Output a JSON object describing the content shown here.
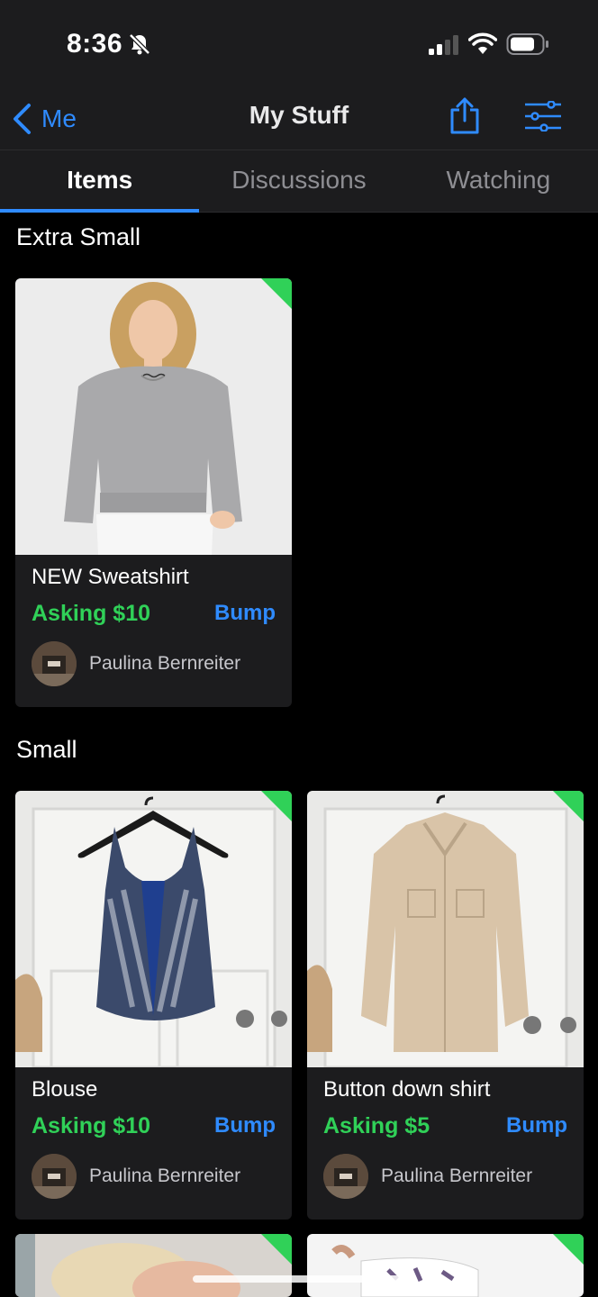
{
  "status_bar": {
    "time": "8:36"
  },
  "nav": {
    "back_label": "Me",
    "title": "My Stuff"
  },
  "tabs": [
    {
      "label": "Items",
      "active": true
    },
    {
      "label": "Discussions",
      "active": false
    },
    {
      "label": "Watching",
      "active": false
    }
  ],
  "sections": [
    {
      "title": "Extra Small",
      "items": [
        {
          "title": "NEW Sweatshirt",
          "price": "Asking $10",
          "action": "Bump",
          "seller": "Paulina Bernreiter"
        }
      ]
    },
    {
      "title": "Small",
      "items": [
        {
          "title": "Blouse",
          "price": "Asking $10",
          "action": "Bump",
          "seller": "Paulina Bernreiter"
        },
        {
          "title": "Button down shirt",
          "price": "Asking $5",
          "action": "Bump",
          "seller": "Paulina Bernreiter"
        }
      ]
    }
  ],
  "colors": {
    "accent": "#2f8bff",
    "price": "#30d158",
    "background": "#000000",
    "card": "#1c1c1e"
  }
}
